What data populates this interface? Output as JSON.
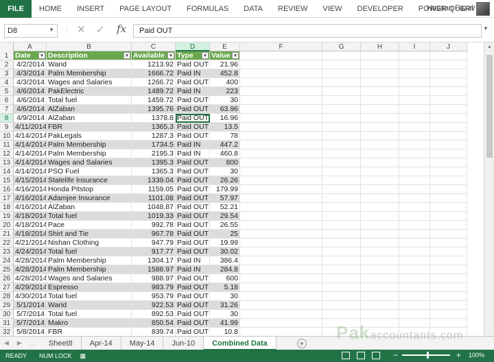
{
  "ribbon": {
    "file": "FILE",
    "tabs": [
      "HOME",
      "INSERT",
      "PAGE LAYOUT",
      "FORMULAS",
      "DATA",
      "REVIEW",
      "VIEW",
      "DEVELOPER",
      "POWER QUERY"
    ],
    "user": "Hasaan Fazal"
  },
  "formula_bar": {
    "name_box": "D8",
    "fx": "fx",
    "formula": "Paid OUT"
  },
  "columns": [
    "A",
    "B",
    "C",
    "D",
    "E",
    "F",
    "G",
    "H",
    "I",
    "J"
  ],
  "table_headers": [
    "Date",
    "Description",
    "Available",
    "Type",
    "Value"
  ],
  "rows": [
    [
      "4/2/2014",
      "Warid",
      "1213.92",
      "Paid OUT",
      "21.96"
    ],
    [
      "4/3/2014",
      "Palm Membership",
      "1666.72",
      "Paid IN",
      "452.8"
    ],
    [
      "4/3/2014",
      "Wages and Salaries",
      "1266.72",
      "Paid OUT",
      "400"
    ],
    [
      "4/6/2014",
      "PakElectric",
      "1489.72",
      "Paid IN",
      "223"
    ],
    [
      "4/6/2014",
      "Total fuel",
      "1459.72",
      "Paid OUT",
      "30"
    ],
    [
      "4/6/2014",
      "AlZaban",
      "1395.76",
      "Paid OUT",
      "63.96"
    ],
    [
      "4/9/2014",
      "AlZaban",
      "1378.8",
      "Paid OUT",
      "16.96"
    ],
    [
      "4/11/2014",
      "FBR",
      "1365.3",
      "Paid OUT",
      "13.5"
    ],
    [
      "4/14/2014",
      "PakLegals",
      "1287.3",
      "Paid OUT",
      "78"
    ],
    [
      "4/14/2014",
      "Palm Membership",
      "1734.5",
      "Paid IN",
      "447.2"
    ],
    [
      "4/14/2014",
      "Palm Membership",
      "2195.3",
      "Paid IN",
      "460.8"
    ],
    [
      "4/14/2014",
      "Wages and Salaries",
      "1395.3",
      "Paid OUT",
      "800"
    ],
    [
      "4/14/2014",
      "PSO Fuel",
      "1365.3",
      "Paid OUT",
      "30"
    ],
    [
      "4/15/2014",
      "Statelife Insurance",
      "1339.04",
      "Paid OUT",
      "26.26"
    ],
    [
      "4/16/2014",
      "Honda Pitstop",
      "1159.05",
      "Paid OUT",
      "179.99"
    ],
    [
      "4/16/2014",
      "Adamjee Insurance",
      "1101.08",
      "Paid OUT",
      "57.97"
    ],
    [
      "4/16/2014",
      "AlZaban",
      "1048.87",
      "Paid OUT",
      "52.21"
    ],
    [
      "4/18/2014",
      "Total fuel",
      "1019.33",
      "Paid OUT",
      "29.54"
    ],
    [
      "4/18/2014",
      "Pace",
      "992.78",
      "Paid OUT",
      "26.55"
    ],
    [
      "4/18/2014",
      "Shirt and Tie",
      "967.78",
      "Paid OUT",
      "25"
    ],
    [
      "4/21/2014",
      "Nishan Clothing",
      "947.79",
      "Paid OUT",
      "19.99"
    ],
    [
      "4/24/2014",
      "Total fuel",
      "917.77",
      "Paid OUT",
      "30.02"
    ],
    [
      "4/28/2014",
      "Palm Membership",
      "1304.17",
      "Paid IN",
      "386.4"
    ],
    [
      "4/28/2014",
      "Palm Membership",
      "1588.97",
      "Paid IN",
      "284.8"
    ],
    [
      "4/28/2014",
      "Wages and Salaries",
      "988.97",
      "Paid OUT",
      "600"
    ],
    [
      "4/29/2014",
      "Espresso",
      "983.79",
      "Paid OUT",
      "5.18"
    ],
    [
      "4/30/2014",
      "Total fuel",
      "953.79",
      "Paid OUT",
      "30"
    ],
    [
      "5/1/2014",
      "Warid",
      "922.53",
      "Paid OUT",
      "31.26"
    ],
    [
      "5/7/2014",
      "Total fuel",
      "892.53",
      "Paid OUT",
      "30"
    ],
    [
      "5/7/2014",
      "Makro",
      "850.54",
      "Paid OUT",
      "41.99"
    ],
    [
      "5/8/2014",
      "FBR",
      "839.74",
      "Paid OUT",
      "10.8"
    ]
  ],
  "sheet_tabs": [
    "Sheet8",
    "Apr-14",
    "May-14",
    "Jun-10",
    "Combined Data"
  ],
  "active_sheet": "Combined Data",
  "watermark": {
    "brand": "Pak",
    "rest": "accountants.com"
  },
  "status": {
    "ready": "READY",
    "num_lock": "NUM LOCK",
    "zoom": "100%"
  },
  "colors": {
    "accent": "#217346",
    "header_fill": "#6aa84f",
    "band": "#dcdcdc"
  }
}
